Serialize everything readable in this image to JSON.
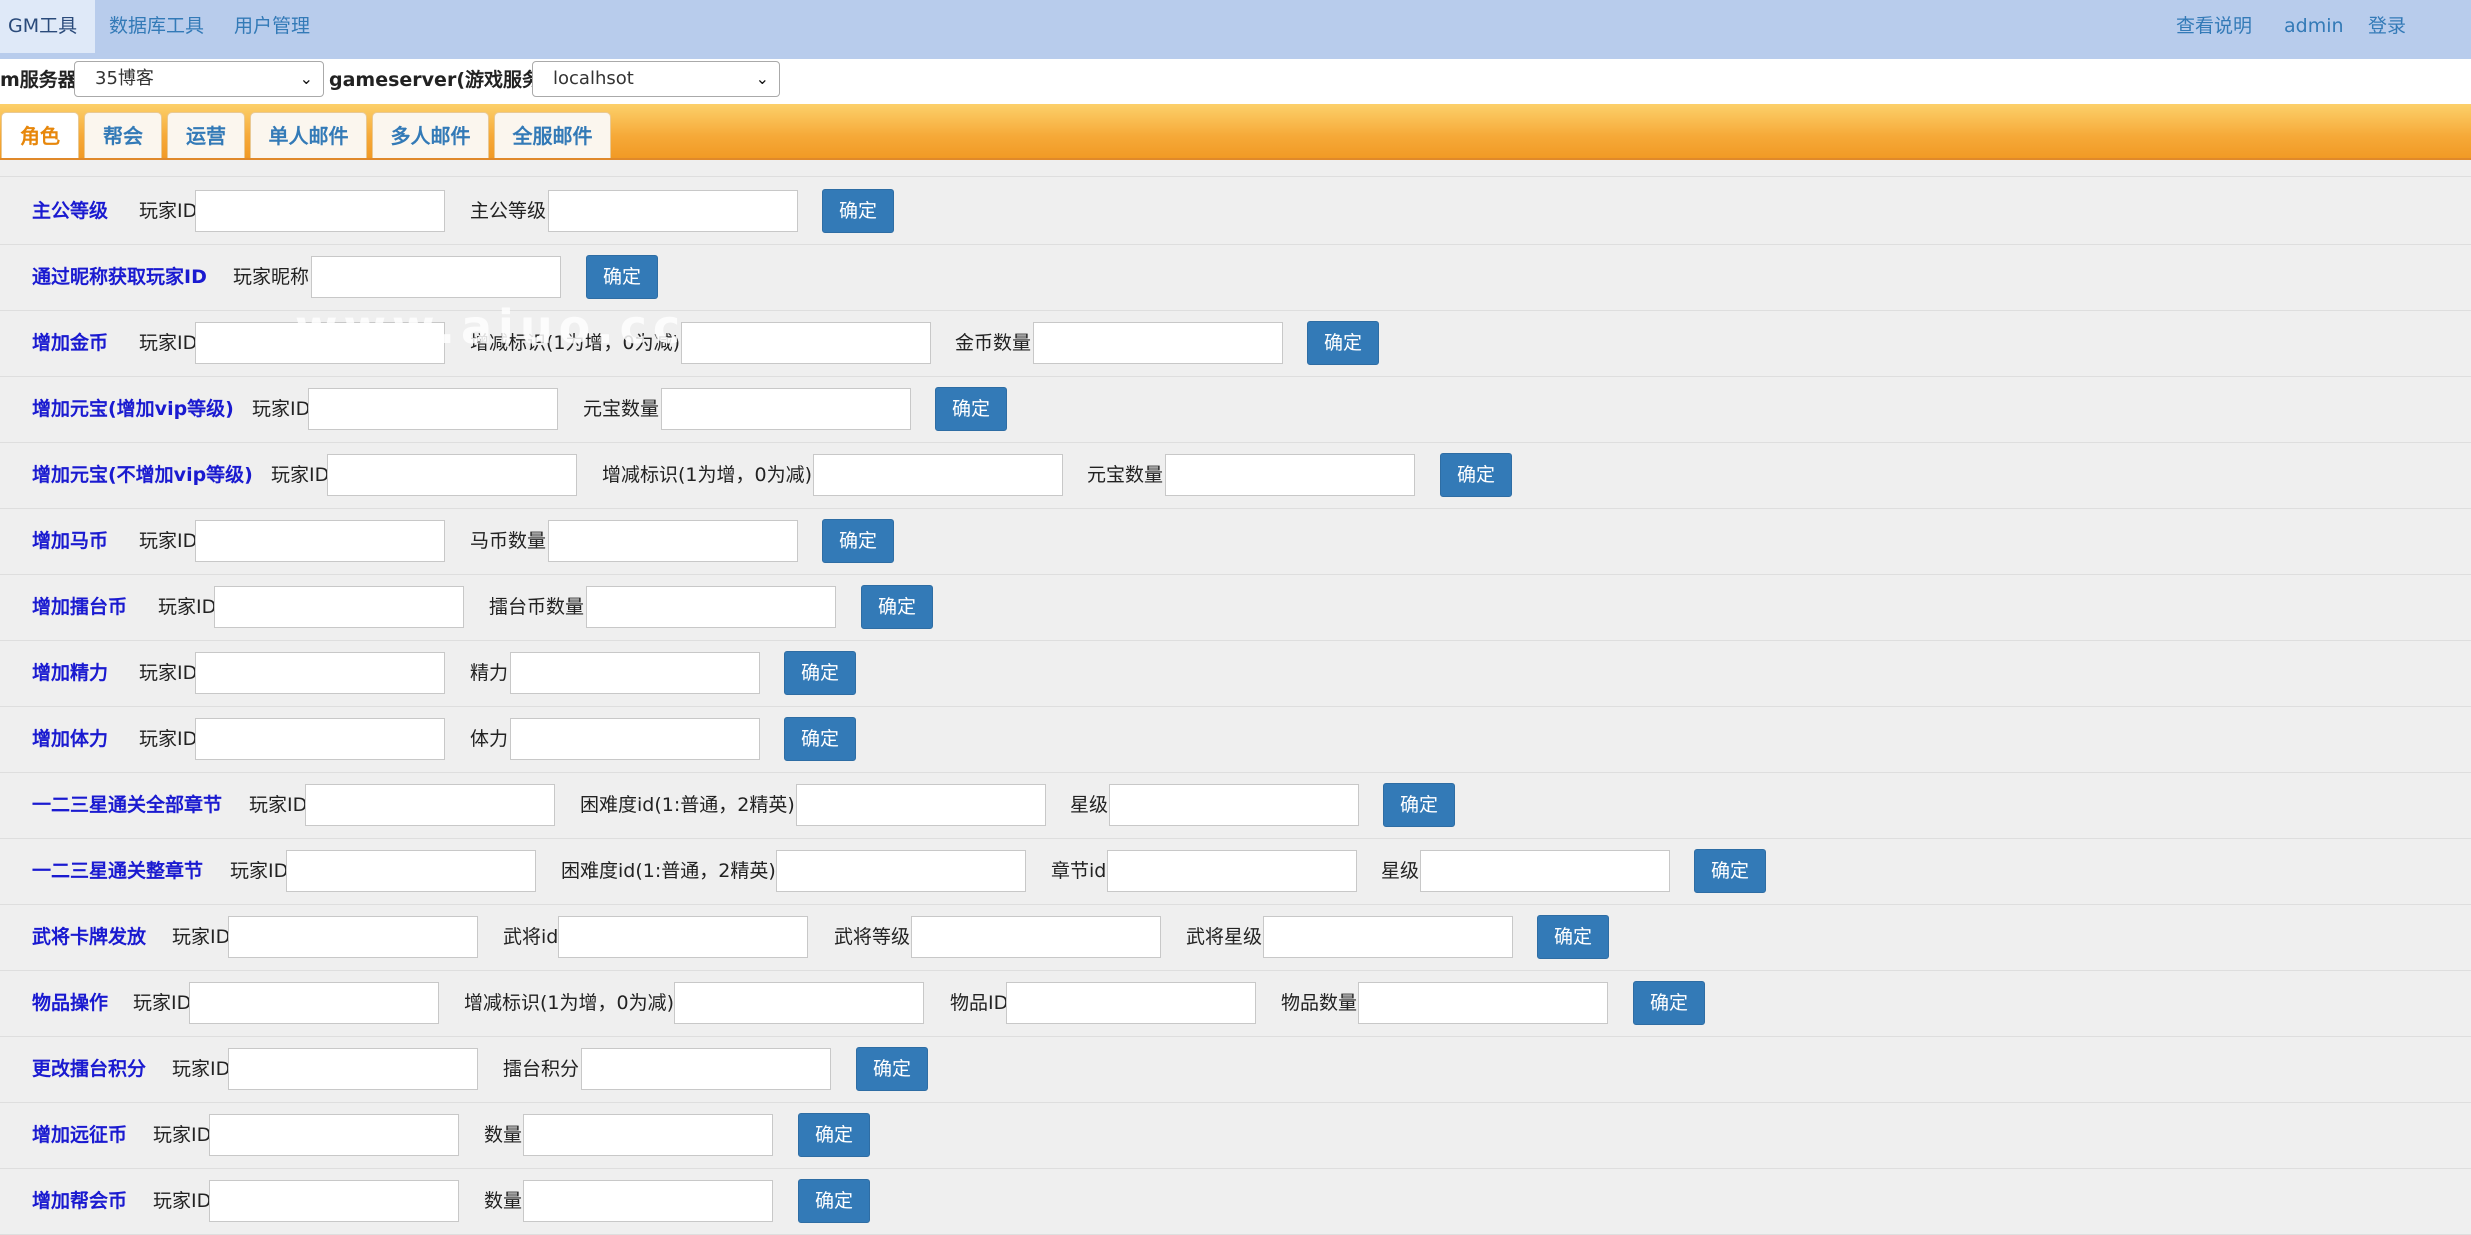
{
  "nav": {
    "left": [
      "GM工具",
      "数据库工具",
      "用户管理"
    ],
    "right": [
      "查看说明",
      "admin",
      "登录"
    ]
  },
  "server": {
    "label1": "m服务器",
    "select1": "35博客",
    "label2": "gameserver(游戏服务器)",
    "select2": "localhsot"
  },
  "tabs": [
    "角色",
    "帮会",
    "运营",
    "单人邮件",
    "多人邮件",
    "全服邮件"
  ],
  "confirm_label": "确定",
  "watermark": "www.aiuo.cc",
  "rows": [
    {
      "title": "主公等级",
      "fields": [
        "玩家ID",
        "主公等级"
      ]
    },
    {
      "title": "通过昵称获取玩家ID",
      "fields": [
        "玩家昵称"
      ]
    },
    {
      "title": "增加金币",
      "fields": [
        "玩家ID",
        "增减标识(1为增，0为减)",
        "金币数量"
      ]
    },
    {
      "title": "增加元宝(增加vip等级)",
      "fields": [
        "玩家ID",
        "元宝数量"
      ]
    },
    {
      "title": "增加元宝(不增加vip等级)",
      "fields": [
        "玩家ID",
        "增减标识(1为增，0为减)",
        "元宝数量"
      ]
    },
    {
      "title": "增加马币",
      "fields": [
        "玩家ID",
        "马币数量"
      ]
    },
    {
      "title": "增加擂台币",
      "fields": [
        "玩家ID",
        "擂台币数量"
      ]
    },
    {
      "title": "增加精力",
      "fields": [
        "玩家ID",
        "精力"
      ]
    },
    {
      "title": "增加体力",
      "fields": [
        "玩家ID",
        "体力"
      ]
    },
    {
      "title": "一二三星通关全部章节",
      "fields": [
        "玩家ID",
        "困难度id(1:普通，2精英)",
        "星级"
      ]
    },
    {
      "title": "一二三星通关整章节",
      "fields": [
        "玩家ID",
        "困难度id(1:普通，2精英)",
        "章节id",
        "星级"
      ]
    },
    {
      "title": "武将卡牌发放",
      "fields": [
        "玩家ID",
        "武将id",
        "武将等级",
        "武将星级"
      ]
    },
    {
      "title": "物品操作",
      "fields": [
        "玩家ID",
        "增减标识(1为增，0为减)",
        "物品ID",
        "物品数量"
      ]
    },
    {
      "title": "更改擂台积分",
      "fields": [
        "玩家ID",
        "擂台积分"
      ]
    },
    {
      "title": "增加远征币",
      "fields": [
        "玩家ID",
        "数量"
      ]
    },
    {
      "title": "增加帮会币",
      "fields": [
        "玩家ID",
        "数量"
      ]
    }
  ]
}
